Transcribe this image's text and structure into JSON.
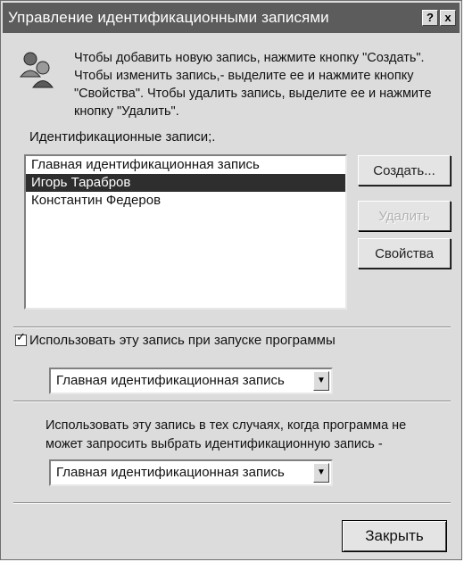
{
  "window": {
    "title": "Управление идентификационными записями",
    "help_label": "?",
    "close_label": "x"
  },
  "info": {
    "text": "Чтобы добавить новую запись, нажмите кнопку \"Создать\". Чтобы изменить запись,- выделите ее и нажмите кнопку \"Свойства\". Чтобы удалить запись, выделите ее и нажмите кнопку \"Удалить\"."
  },
  "identities": {
    "label": "Идентификационные записи;.",
    "items": [
      {
        "name": "Главная идентификационная запись",
        "selected": false
      },
      {
        "name": "Игорь Тарабров",
        "selected": true
      },
      {
        "name": "Константин Федеров",
        "selected": false
      }
    ]
  },
  "buttons": {
    "create": "Создать...",
    "delete": "Удалить",
    "properties": "Свойства",
    "close": "Закрыть"
  },
  "startup": {
    "checkbox_label": "Использовать эту запись при запуске программы",
    "checked": true,
    "check_mark": "✓",
    "selected_value": "Главная идентификационная запись",
    "arrow": "▼"
  },
  "fallback": {
    "text": "Использовать эту запись в тех случаях, когда программа не может запросить выбрать идентификационную запись -",
    "selected_value": "Главная идентификационная запись",
    "arrow": "▼"
  }
}
